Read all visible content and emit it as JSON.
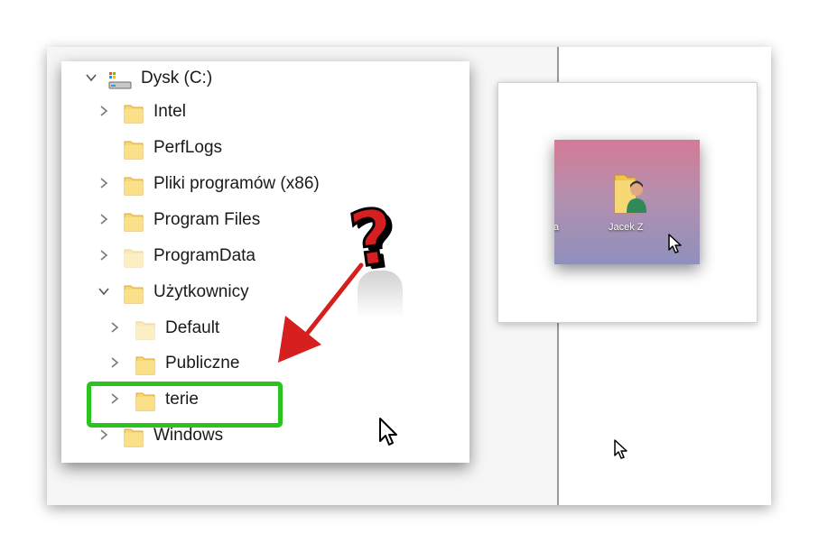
{
  "tree": {
    "drive_label": "Dysk (C:)",
    "items": [
      {
        "label": "Intel"
      },
      {
        "label": "PerfLogs"
      },
      {
        "label": "Pliki programów (x86)"
      },
      {
        "label": "Program Files"
      },
      {
        "label": "ProgramData"
      },
      {
        "label": "Użytkownicy"
      },
      {
        "label": "Default"
      },
      {
        "label": "Publiczne"
      },
      {
        "label": "terie"
      },
      {
        "label": "Windows"
      }
    ]
  },
  "desktop": {
    "folder_label": "Jacek Z",
    "partial_label": "a"
  },
  "annotation": {
    "question_mark": "?",
    "highlight_color": "#2bc41f",
    "arrow_color": "#d62020"
  }
}
